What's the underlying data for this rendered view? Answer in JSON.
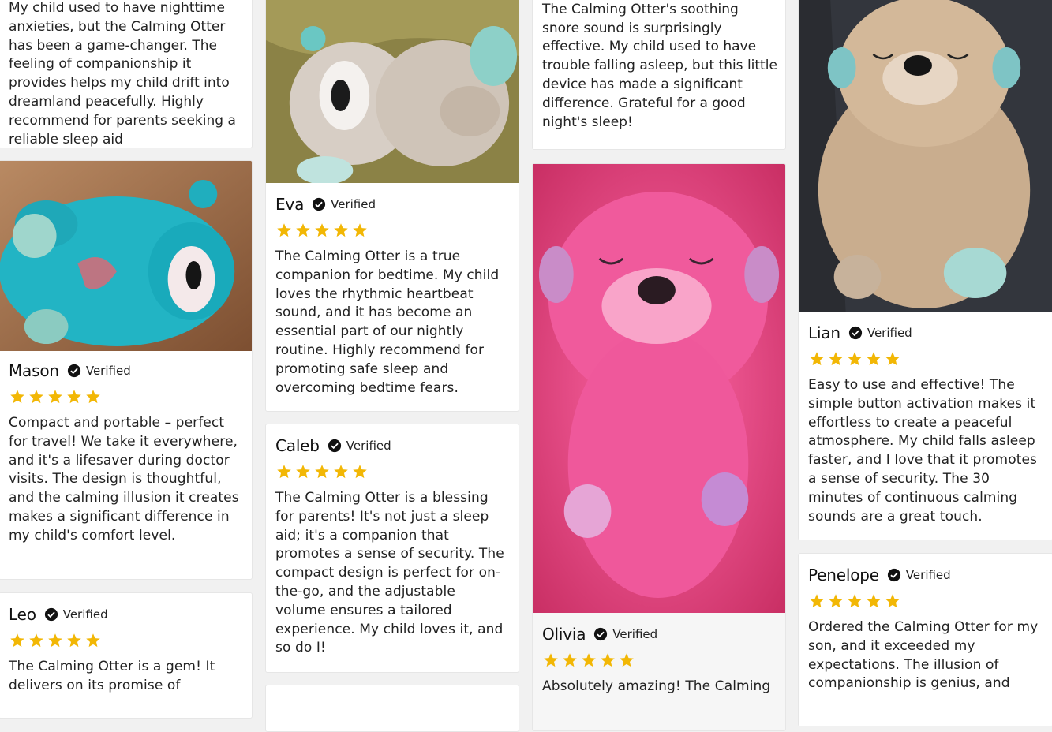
{
  "verified_label": "Verified",
  "star_color": "#f2b705",
  "cards": {
    "top_left_text": "My child used to have nighttime anxieties, but the Calming Otter has been a game-changer. The feeling of companionship it provides helps my child drift into dreamland peacefully. Highly recommend for parents seeking a reliable sleep aid",
    "top_right_text": "Transformed our bedtime routine! The Calming Otter's soothing snore sound is surprisingly effective. My child used to have trouble falling asleep, but this little device has made a significant difference. Grateful for a good night's sleep!",
    "mason": {
      "name": "Mason",
      "rating": 5,
      "text": "Compact and portable – perfect for travel! We take it everywhere, and it's a lifesaver during doctor visits. The design is thoughtful, and the calming illusion it creates makes a significant difference in my child's comfort level."
    },
    "leo": {
      "name": "Leo",
      "rating": 5,
      "text": "The Calming Otter is a gem! It delivers on its promise of"
    },
    "eva": {
      "name": "Eva",
      "rating": 5,
      "text": "The Calming Otter is a true companion for bedtime. My child loves the rhythmic heartbeat sound, and it has become an essential part of our nightly routine. Highly recommend for promoting safe sleep and overcoming bedtime fears."
    },
    "caleb": {
      "name": "Caleb",
      "rating": 5,
      "text": "The Calming Otter is a blessing for parents! It's not just a sleep aid; it's a companion that promotes a sense of security. The compact design is perfect for on-the-go, and the adjustable volume ensures a tailored experience. My child loves it, and so do I!"
    },
    "olivia": {
      "name": "Olivia",
      "rating": 5,
      "text": "Absolutely amazing! The Calming"
    },
    "lian": {
      "name": "Lian",
      "rating": 5,
      "text": "Easy to use and effective! The simple button activation makes it effortless to create a peaceful atmosphere. My child falls asleep faster, and I love that it promotes a sense of security. The 30 minutes of continuous calming sounds are a great touch."
    },
    "penelope": {
      "name": "Penelope",
      "rating": 5,
      "text": "Ordered the Calming Otter for my son, and it exceeded my expectations. The illusion of companionship is genius, and"
    }
  }
}
